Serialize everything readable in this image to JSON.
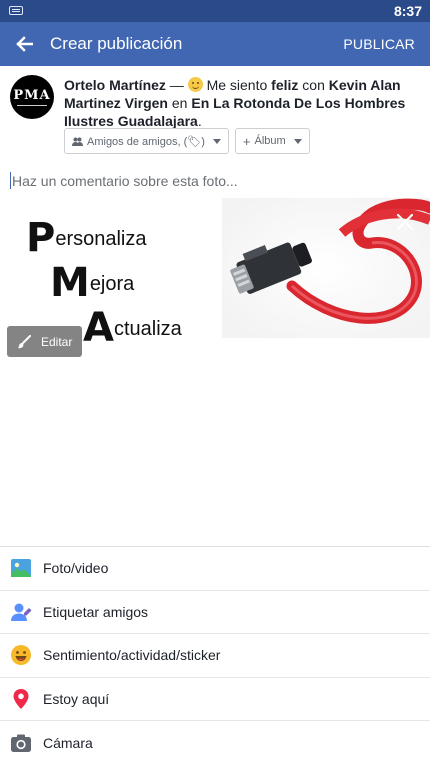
{
  "status_bar": {
    "time": "8:37"
  },
  "app_bar": {
    "title": "Crear publicación",
    "action": "PUBLICAR"
  },
  "post": {
    "author": "Ortelo Martínez",
    "dash": " — ",
    "feeling_prefix": " Me siento ",
    "feeling": "feliz",
    "with_word": " con ",
    "tagged": "Kevin Alan Martinez Virgen",
    "at_word": " en ",
    "location": "En La Rotonda De Los Hombres Ilustres Guadalajara",
    "period": ".",
    "avatar_logo": "PMA"
  },
  "chips": {
    "audience": "Amigos de amigos, (🏷)",
    "album": "Álbum"
  },
  "comment": {
    "placeholder": "Haz un comentario sobre esta foto..."
  },
  "photo": {
    "lines": [
      {
        "cap": "P",
        "rest": "ersonaliza"
      },
      {
        "cap": "M",
        "rest": "ejora"
      },
      {
        "cap": "A",
        "rest": "ctualiza"
      }
    ],
    "edit_label": "Editar"
  },
  "options": [
    {
      "label": "Foto/video",
      "icon": "photo-icon"
    },
    {
      "label": "Etiquetar amigos",
      "icon": "tag-friends-icon"
    },
    {
      "label": "Sentimiento/actividad/sticker",
      "icon": "smile-icon"
    },
    {
      "label": "Estoy aquí",
      "icon": "location-pin-icon"
    },
    {
      "label": "Cámara",
      "icon": "camera-icon"
    }
  ],
  "colors": {
    "brand": "#4267b2",
    "status_bar": "#2b4a8a"
  }
}
